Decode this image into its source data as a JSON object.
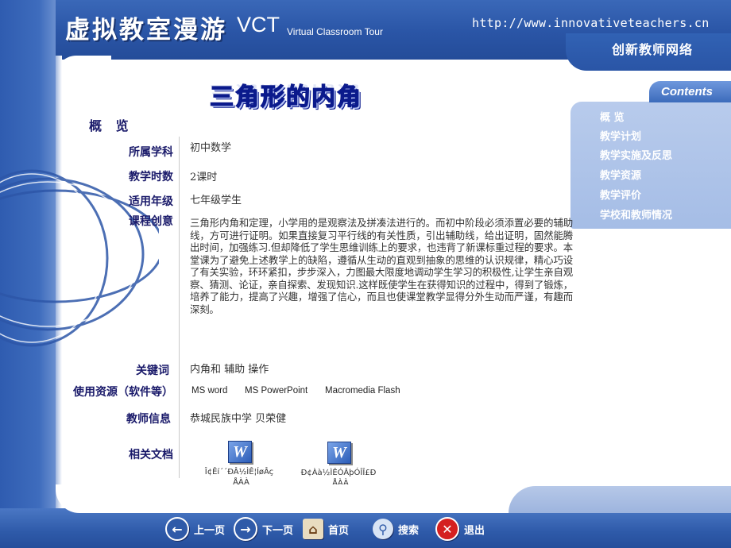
{
  "header": {
    "title_cn": "虚拟教室漫游",
    "title_vct": "VCT",
    "subtitle": "Virtual Classroom Tour",
    "url": "http://www.innovativeteachers.cn",
    "network_name": "创新教师网络"
  },
  "page": {
    "heading": "三角形的内角"
  },
  "sidebar": {
    "tab_label": "Contents",
    "items": [
      {
        "label": "概  览"
      },
      {
        "label": "教学计划"
      },
      {
        "label": "教学实施及反思"
      },
      {
        "label": "教学资源"
      },
      {
        "label": "教学评价"
      },
      {
        "label": "学校和教师情况"
      }
    ]
  },
  "overview": {
    "heading": "概 览",
    "subject_label": "所属学科",
    "subject_value": "初中数学",
    "hours_label": "教学时数",
    "hours_value": "2课时",
    "grade_label": "适用年级",
    "grade_value": "七年级学生",
    "idea_label": "课程创意",
    "idea_text": "三角形内角和定理，小学用的是观察法及拼凑法进行的。而初中阶段必须添置必要的辅助线，方可进行证明。如果直接复习平行线的有关性质，引出辅助线，给出证明，固然能腾出时间，加强练习.但却降低了学生思维训练上的要求，也违背了新课标重过程的要求。本堂课为了避免上述教学上的缺陷，遵循从生动的直观到抽象的思维的认识规律，精心巧设了有关实验，环环紧扣，步步深入，力图最大限度地调动学生学习的积极性,让学生亲自观察、猜测、论证，亲自探索、发现知识.这样既使学生在获得知识的过程中，得到了锻炼，培养了能力，提高了兴趣，增强了信心，而且也使课堂教学显得分外生动而严谨，有趣而深刻。",
    "keywords_label": "关键词",
    "keywords_value": "内角和   辅助   操作",
    "resources_label": "使用资源（软件等）",
    "resources": [
      "MS word",
      "MS PowerPoint",
      "Macromedia  Flash"
    ],
    "teacher_label": "教师信息",
    "teacher_value": "恭城民族中学  贝荣健",
    "docs_label": "相关文档",
    "docs": [
      {
        "icon_letter": "W",
        "caption_line1": "Î¢Êí´´ÐÂ½ÌÊ¦ÍøÂç",
        "caption_line2": "¸ÅÀÀ"
      },
      {
        "icon_letter": "W",
        "caption_line1": "Ð¢Àà½ÌÊÓÂþÓÎÎ£Ð",
        "caption_line2": "¸ÅÀÀ"
      }
    ]
  },
  "bottom_nav": {
    "prev_label": "上一页",
    "next_label": "下一页",
    "home_label": "首页",
    "search_label": "搜索",
    "exit_label": "退出",
    "prev_icon": "arrow-left-icon",
    "next_icon": "arrow-right-icon",
    "home_icon": "house-icon",
    "search_icon": "magnifier-icon",
    "exit_icon": "close-icon"
  },
  "colors": {
    "brand_blue": "#2a55a6",
    "heading_blue": "#0b1a8c",
    "label_navy": "#1a1a6a",
    "exit_red": "#d42020"
  }
}
